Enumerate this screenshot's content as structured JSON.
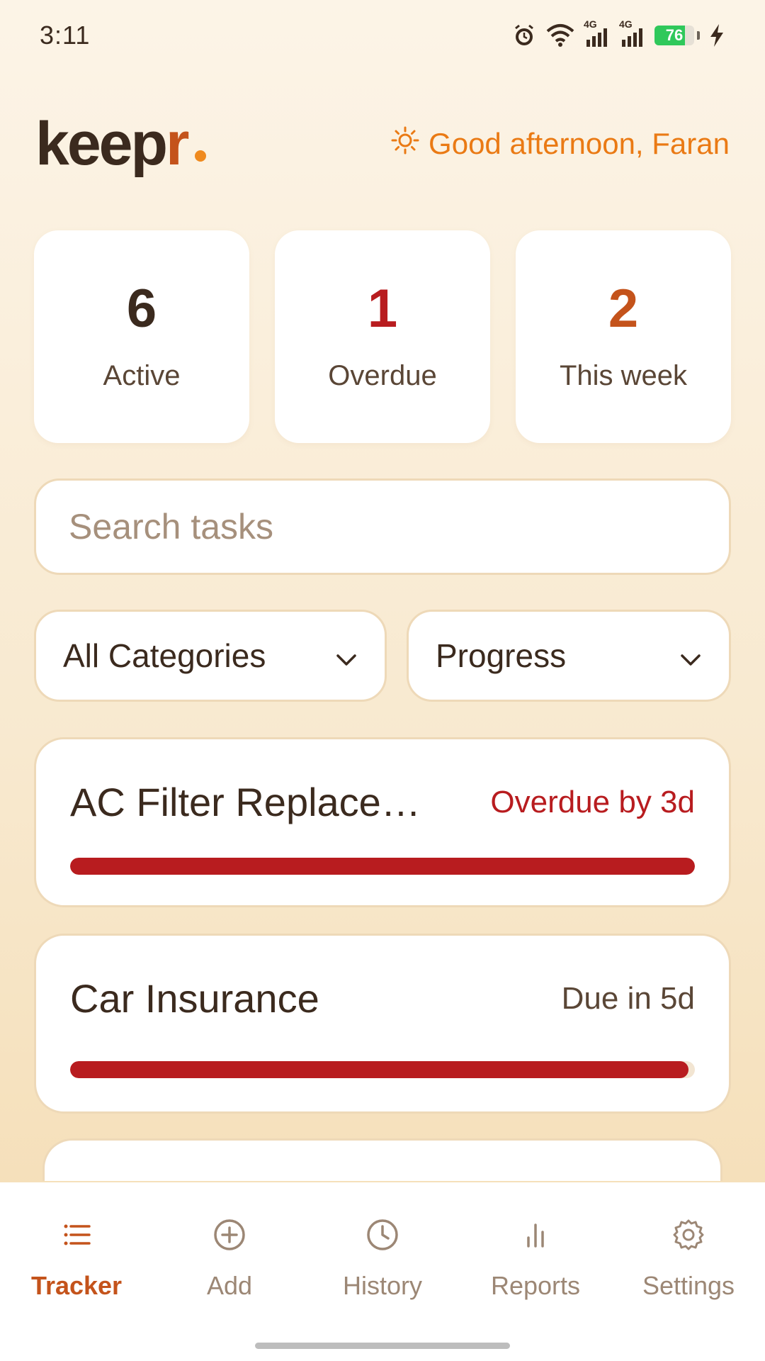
{
  "status_bar": {
    "time": "3:11",
    "network_label_1": "4G",
    "network_label_2": "4G",
    "battery_percent": "76",
    "battery_level": 0.76,
    "battery_color": "#2fc85b",
    "icons": [
      "alarm-icon",
      "wifi-icon",
      "signal-icon",
      "signal-icon",
      "battery-icon",
      "charging-icon"
    ]
  },
  "header": {
    "logo_main": "keep",
    "logo_accent": "r",
    "greeting": "Good afternoon, Faran",
    "greeting_icon": "sun-icon"
  },
  "stats": [
    {
      "value": "6",
      "label": "Active",
      "color": "#3b2a1e"
    },
    {
      "value": "1",
      "label": "Overdue",
      "color": "#b81c1f"
    },
    {
      "value": "2",
      "label": "This week",
      "color": "#c4531b"
    }
  ],
  "search": {
    "placeholder": "Search tasks",
    "value": ""
  },
  "filters": {
    "category": "All Categories",
    "sort": "Progress"
  },
  "tasks": [
    {
      "title": "AC Filter Replacement",
      "due": "Overdue by 3d",
      "due_color": "#b81c1f",
      "progress": 1.0,
      "bar_color": "#b81c1f"
    },
    {
      "title": "Car Insurance",
      "due": "Due in 5d",
      "due_color": "#5a4636",
      "progress": 0.99,
      "bar_color": "#b81c1f"
    }
  ],
  "nav": {
    "items": [
      {
        "label": "Tracker",
        "icon": "list-icon",
        "active": true
      },
      {
        "label": "Add",
        "icon": "plus-circle-icon",
        "active": false
      },
      {
        "label": "History",
        "icon": "clock-icon",
        "active": false
      },
      {
        "label": "Reports",
        "icon": "bar-chart-icon",
        "active": false
      },
      {
        "label": "Settings",
        "icon": "gear-icon",
        "active": false
      }
    ]
  },
  "colors": {
    "accent": "#c4531b",
    "accent_light": "#ea7a14",
    "danger": "#b81c1f",
    "text": "#3b2a1e",
    "muted": "#9c8775"
  }
}
